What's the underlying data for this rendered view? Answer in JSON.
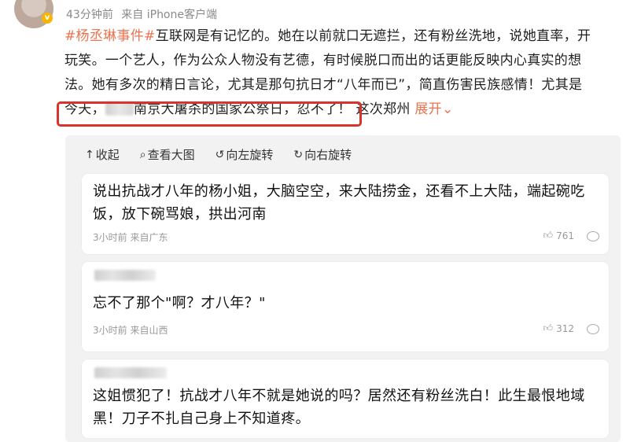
{
  "header": {
    "time": "43分钟前",
    "source": "来自 iPhone客户端"
  },
  "post": {
    "tag": "#杨丞琳事件#",
    "line1_rest": "互联网是有记忆的。她在以前就口无遮拦，还有粉丝洗地，说她直率，开",
    "line2": "玩笑。一个艺人，作为公众人物没有艺德，有时候脱口而出的话更能反映内心真实的想",
    "line3": "法。她有多次的精日言论，尤其是那句抗日才“八年而已”，简直伤害民族感情！尤其是",
    "line4_a": "今天，",
    "line4_b": "南京大屠杀的国家公祭日，忍不了！",
    "line4_c": "这次郑州",
    "expand": "展开"
  },
  "toolbar": {
    "collapse": "收起",
    "view_large": "查看大图",
    "rotate_left": "向左旋转",
    "rotate_right": "向右旋转"
  },
  "comments": [
    {
      "text": "说出抗战才八年的杨小姐，大脑空空，来大陆捞金，还看不上大陆，端起碗吃饭，放下碗骂娘，拱出河南",
      "meta": "3小时前 来自广东",
      "likes": "761"
    },
    {
      "text": "忘不了那个\"啊？才八年？\"",
      "meta": "3小时前 来自山西",
      "likes": "312"
    },
    {
      "text": "这姐惯犯了！抗战才八年不就是她说的吗？居然还有粉丝洗白！此生最恨地域黑！刀子不扎自己身上不知道疼。",
      "meta": "",
      "likes": ""
    }
  ],
  "icons": {
    "collapse": "arrow-up-icon",
    "view_large": "search-icon",
    "rotate_left": "rotate-left-icon",
    "rotate_right": "rotate-right-icon",
    "like": "thumbs-up-icon",
    "comment": "comment-icon",
    "expand": "chevron-down-icon"
  },
  "colors": {
    "accent": "#eb7350",
    "highlight_border": "#d9342b"
  }
}
